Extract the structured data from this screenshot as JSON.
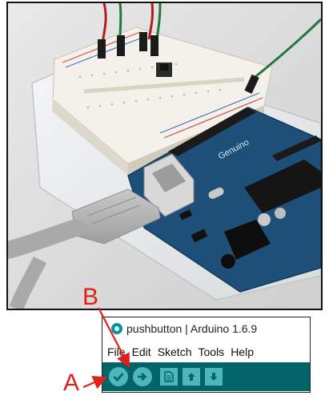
{
  "window": {
    "title": "pushbutton | Arduino 1.6.9"
  },
  "menu": {
    "items": [
      "File",
      "Edit",
      "Sketch",
      "Tools",
      "Help"
    ]
  },
  "toolbar": {
    "buttons": [
      {
        "icon": "checkmark-icon",
        "action": "verify"
      },
      {
        "icon": "right-arrow-icon",
        "action": "upload"
      },
      {
        "icon": "new-document-icon",
        "action": "new"
      },
      {
        "icon": "up-arrow-icon",
        "action": "open"
      },
      {
        "icon": "down-arrow-icon",
        "action": "save"
      }
    ]
  },
  "annotations": {
    "label_a": "A",
    "label_b": "B",
    "arrow_color": "#e0201b"
  },
  "photo": {
    "board_text": "Genuino"
  },
  "colors": {
    "toolbar_bg": "#006468",
    "toolbar_button": "#4db7bb",
    "board": "#1d4f78"
  }
}
